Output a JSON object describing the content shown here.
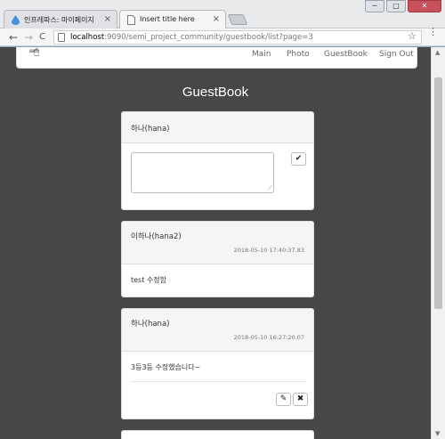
{
  "browser": {
    "tabs": [
      {
        "label": "인프레파스: 마이페이지",
        "close": "×"
      },
      {
        "label": "Insert title here",
        "close": "×"
      }
    ],
    "window_buttons": [
      "─",
      "□",
      "✕"
    ],
    "back": "←",
    "forward": "→",
    "reload": "C",
    "url_host": "localhost",
    "url_path": ":9090/semi_project_community/guestbook/list?page=3",
    "star": "☆",
    "menu": "⋮"
  },
  "site": {
    "logo": "⌨🖱",
    "nav": [
      "Main",
      "Photo",
      "GuestBook",
      "Sign Out"
    ]
  },
  "page": {
    "title": "GuestBook"
  },
  "write_form": {
    "author": "하나(hana)",
    "submit_icon": "✔",
    "textarea_value": ""
  },
  "posts": [
    {
      "author": "이하나(hana2)",
      "date": "2018-05-10 17:40:37.83",
      "text": "test 수정함"
    },
    {
      "author": "하나(hana)",
      "date": "2018-05-10 16:27:20.07",
      "text": "3등3등 수정했습니다~",
      "edit_icon": "✎",
      "delete_icon": "✖"
    }
  ],
  "colors": {
    "page_bg": "#474747",
    "card_bg": "#ffffff",
    "card_head_bg": "#f5f5f5",
    "title_text": "#ffffff"
  }
}
